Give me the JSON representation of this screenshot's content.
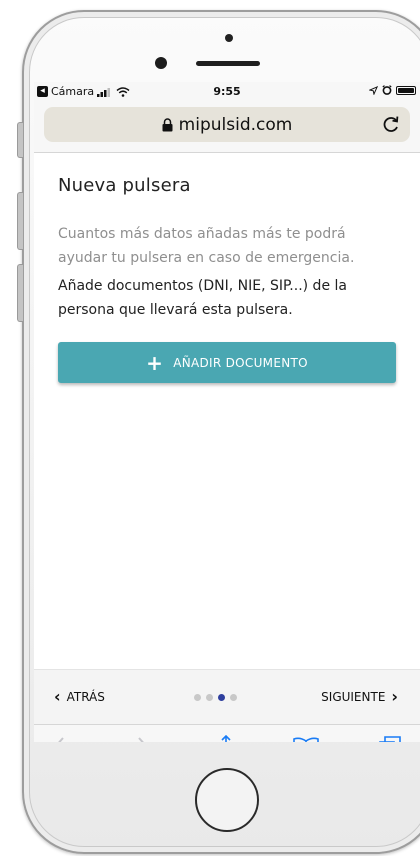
{
  "status_bar": {
    "back_app_label": "Cámara",
    "time": "9:55"
  },
  "browser": {
    "url": "mipulsid.com"
  },
  "page": {
    "title": "Nueva pulsera",
    "hint": "Cuantos más datos añadas más te podrá ayudar tu pulsera en caso de emergencia.",
    "instruction": "Añade documentos (DNI, NIE, SIP...) de la persona que llevará esta pulsera.",
    "add_document_button": "AÑADIR DOCUMENTO"
  },
  "wizard_nav": {
    "back_label": "ATRÁS",
    "next_label": "SIGUIENTE",
    "step_count": 4,
    "current_step": 3
  },
  "colors": {
    "accent_button": "#4aa7b2",
    "active_dot": "#2f3f9e",
    "inactive_dot": "#c8c8c8",
    "safari_icon_blue": "#1a7cf5",
    "safari_icon_disabled": "#c7c7cc"
  },
  "icons": {
    "lock": "lock-icon",
    "reload": "reload-icon",
    "share": "share-icon",
    "bookmarks": "bookmarks-icon",
    "tabs": "tabs-icon"
  }
}
